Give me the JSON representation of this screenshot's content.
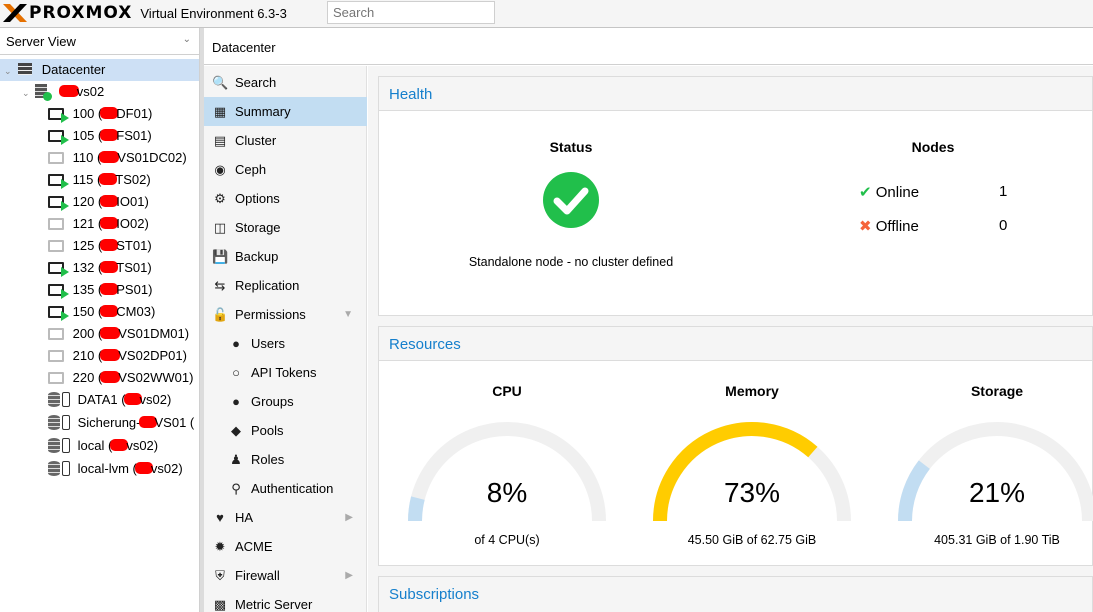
{
  "header": {
    "brand": "PROXMOX",
    "version": "Virtual Environment 6.3-3",
    "search_placeholder": "Search"
  },
  "sidebar": {
    "view_label": "Server View",
    "datacenter_label": "Datacenter",
    "node_label": "vs02",
    "guests": [
      {
        "label": "100 (",
        "tail": "DF01)",
        "running": true
      },
      {
        "label": "105 (",
        "tail": "FS01)",
        "running": true
      },
      {
        "label": "110 (",
        "tail": "VS01DC02)",
        "running": false
      },
      {
        "label": "115 (",
        "tail": "TS02)",
        "running": true
      },
      {
        "label": "120 (",
        "tail": "IO01)",
        "running": true
      },
      {
        "label": "121 (",
        "tail": "IO02)",
        "running": false
      },
      {
        "label": "125 (",
        "tail": "ST01)",
        "running": false
      },
      {
        "label": "132 (",
        "tail": "TS01)",
        "running": true
      },
      {
        "label": "135 (",
        "tail": "PS01)",
        "running": true
      },
      {
        "label": "150 (",
        "tail": "CM03)",
        "running": true
      },
      {
        "label": "200 (",
        "tail": "VS01DM01)",
        "running": false
      },
      {
        "label": "210 (",
        "tail": "VS02DP01)",
        "running": false
      },
      {
        "label": "220 (",
        "tail": "VS02WW01)",
        "running": false
      }
    ],
    "storages": [
      {
        "label": "DATA1 (",
        "tail": "vs02)"
      },
      {
        "label": "Sicherung-",
        "tail": "VS01 ("
      },
      {
        "label": "local (",
        "tail": "vs02)"
      },
      {
        "label": "local-lvm (",
        "tail": "vs02)"
      }
    ]
  },
  "breadcrumb": "Datacenter",
  "menu": [
    {
      "label": "Search",
      "icon": "search-icon"
    },
    {
      "label": "Summary",
      "icon": "book-icon"
    },
    {
      "label": "Cluster",
      "icon": "server-icon"
    },
    {
      "label": "Ceph",
      "icon": "ceph-icon"
    },
    {
      "label": "Options",
      "icon": "gear-icon"
    },
    {
      "label": "Storage",
      "icon": "database-icon"
    },
    {
      "label": "Backup",
      "icon": "floppy-icon"
    },
    {
      "label": "Replication",
      "icon": "retweet-icon"
    },
    {
      "label": "Permissions",
      "icon": "unlock-icon"
    },
    {
      "label": "Users",
      "icon": "user-icon"
    },
    {
      "label": "API Tokens",
      "icon": "user-outline-icon"
    },
    {
      "label": "Groups",
      "icon": "users-icon"
    },
    {
      "label": "Pools",
      "icon": "tags-icon"
    },
    {
      "label": "Roles",
      "icon": "male-icon"
    },
    {
      "label": "Authentication",
      "icon": "key-icon"
    },
    {
      "label": "HA",
      "icon": "heartbeat-icon"
    },
    {
      "label": "ACME",
      "icon": "certificate-icon"
    },
    {
      "label": "Firewall",
      "icon": "shield-icon"
    },
    {
      "label": "Metric Server",
      "icon": "bar-chart-icon"
    }
  ],
  "health": {
    "title": "Health",
    "status_heading": "Status",
    "status_text": "Standalone node - no cluster defined",
    "nodes_heading": "Nodes",
    "online_label": "Online",
    "online_count": "1",
    "offline_label": "Offline",
    "offline_count": "0"
  },
  "resources": {
    "title": "Resources",
    "gauges": [
      {
        "heading": "CPU",
        "value": "8%",
        "fraction": 0.08,
        "detail": "of 4 CPU(s)",
        "color": "#c2ddf2"
      },
      {
        "heading": "Memory",
        "value": "73%",
        "fraction": 0.73,
        "detail": "45.50 GiB of 62.75 GiB",
        "color": "#ffcc00"
      },
      {
        "heading": "Storage",
        "value": "21%",
        "fraction": 0.21,
        "detail": "405.31 GiB of 1.90 TiB",
        "color": "#c2ddf2"
      }
    ]
  },
  "subscriptions": {
    "title": "Subscriptions"
  },
  "colors": {
    "accent": "#157fcc",
    "ok_green": "#21bf4b",
    "error_red": "#f5643a",
    "selection": "#c2ddf2"
  }
}
